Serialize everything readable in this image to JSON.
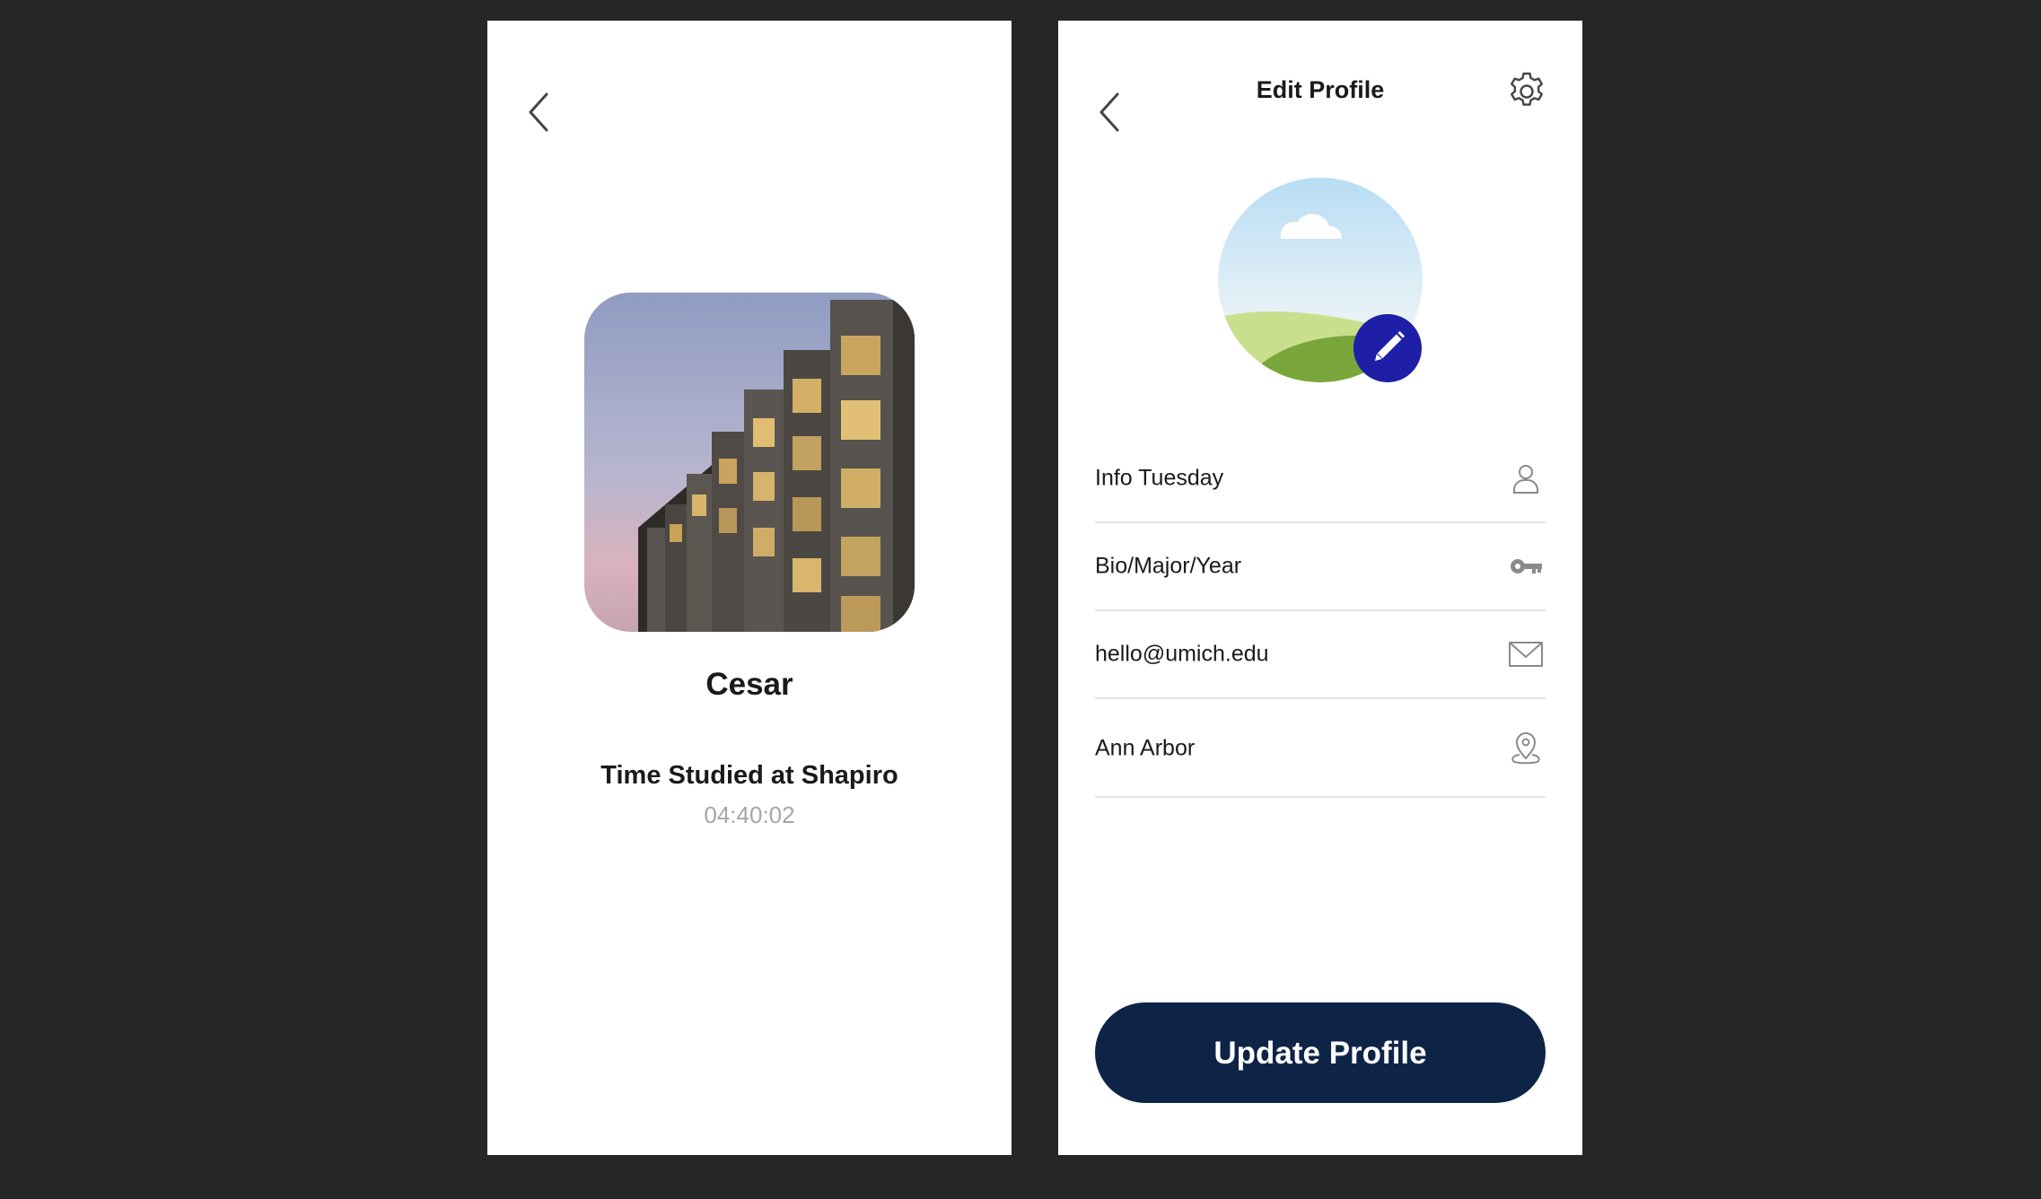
{
  "profile_screen": {
    "user_name": "Cesar",
    "time_heading": "Time Studied at Shapiro",
    "time_value": "04:40:02",
    "back_icon": "chevron-left-icon",
    "photo_icon": "building-photo"
  },
  "edit_screen": {
    "title": "Edit Profile",
    "back_icon": "chevron-left-icon",
    "settings_icon": "gear-icon",
    "edit_avatar_icon": "pencil-icon",
    "fields": [
      {
        "value": "Info Tuesday",
        "icon": "user-icon"
      },
      {
        "value": "Bio/Major/Year",
        "icon": "key-icon"
      },
      {
        "value": "hello@umich.edu",
        "icon": "mail-icon"
      },
      {
        "value": "Ann Arbor",
        "icon": "location-pin-icon"
      }
    ],
    "update_button": "Update Profile"
  },
  "colors": {
    "background": "#262626",
    "screen": "#ffffff",
    "button": "#0e2447",
    "accent": "#1e1fa6",
    "muted_text": "#a6a6a6",
    "divider": "#e3e3e3"
  }
}
